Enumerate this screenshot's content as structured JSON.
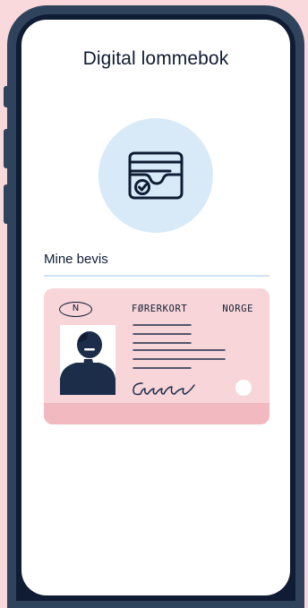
{
  "app": {
    "title": "Digital lommebok"
  },
  "hero": {
    "icon": "wallet-check-icon",
    "background": "#d8eaf8"
  },
  "section": {
    "label": "Mine bevis"
  },
  "license_card": {
    "country_code": "N",
    "type": "FØRERKORT",
    "country": "NORGE",
    "photo_icon": "person-silhouette-icon",
    "signature_icon": "signature-icon",
    "colors": {
      "card": "#f8d5d9",
      "band": "#f3b9c0"
    }
  },
  "colors": {
    "background": "#f9d9dc",
    "phone_frame": "#2f435d",
    "text": "#0f1c33"
  }
}
